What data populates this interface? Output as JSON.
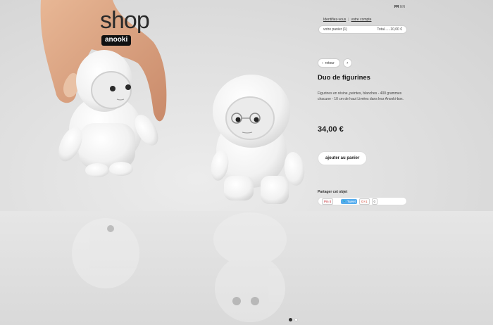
{
  "logo": {
    "word": "shop",
    "badge": "anooki"
  },
  "lang": {
    "active": "FR",
    "other": "EN"
  },
  "account": {
    "login": "Identifiez-vous",
    "account": "votre compte"
  },
  "cart": {
    "label": "votre panier (1)",
    "total": "Total......10,00 €"
  },
  "nav": {
    "back_label": "retour",
    "back_icon": "chevron-left-icon",
    "next_icon": "chevron-right-icon"
  },
  "product": {
    "title": "Duo de figurines",
    "description": "Figurines en résine, peintes, blanches - 400 grammes chacune - 10 cm de haut Livrées dans leur Anooki-box.",
    "price": "34,00 €",
    "add_to_cart": "ajouter au panier"
  },
  "share": {
    "label": "Partager cet objet",
    "pinterest": "Pin it",
    "tweet": "Tweet",
    "gplus": "G+1",
    "count": "0"
  },
  "carousel": {
    "slides": 2,
    "active": 1
  }
}
